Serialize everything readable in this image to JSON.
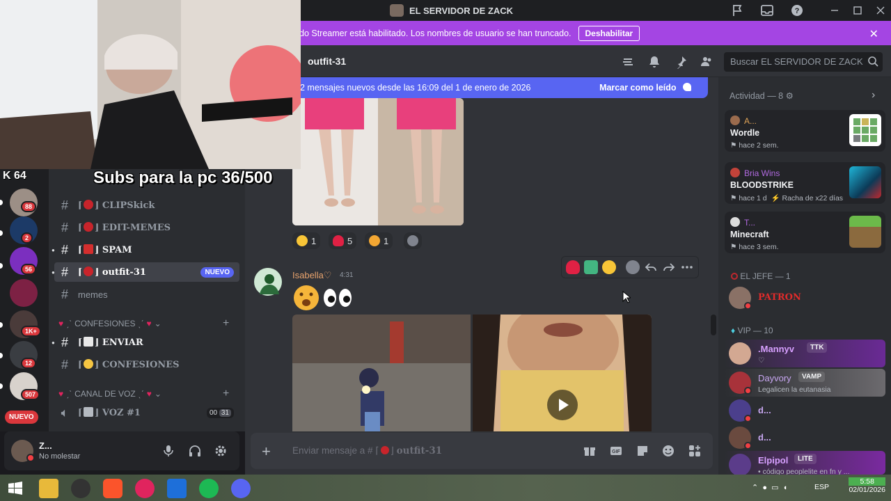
{
  "window": {
    "title": "EL SERVIDOR DE ZACK"
  },
  "banner": {
    "text": "do Streamer está habilitado. Los nombres de usuario se han truncado.",
    "button": "Deshabilitar",
    "close": "✕"
  },
  "overlay": {
    "subs": "Subs para la pc 36/500",
    "kick_viewers": "64"
  },
  "guilds": {
    "badges": [
      "88",
      "2",
      "56",
      "1K+",
      "12",
      "507"
    ],
    "new_label": "NUEVO"
  },
  "channels": {
    "items": [
      {
        "label": "CLIPSkick"
      },
      {
        "label": "EDIT-MEMES"
      },
      {
        "label": "SPAM"
      },
      {
        "label": "outfit-31",
        "badge": "NUEVO"
      },
      {
        "label": "memes"
      }
    ],
    "cat_confesiones": "CONFESIONES",
    "confesiones_items": [
      {
        "label": "ENVIAR"
      },
      {
        "label": "CONFESIONES"
      }
    ],
    "cat_voz": "CANAL DE VOZ",
    "voice": {
      "label": "VOZ #1",
      "count_a": "00",
      "count_b": "31"
    }
  },
  "user": {
    "name": "Z...",
    "status": "No molestar"
  },
  "chat": {
    "channel": "outfit-31",
    "search_placeholder": "Buscar EL SERVIDOR DE ZACK",
    "new_messages": "2 mensajes nuevos desde las 16:09 del 1 de enero de 2026",
    "mark_read": "Marcar como leído",
    "reactions": [
      {
        "emoji": "heart-eyes",
        "count": "1"
      },
      {
        "emoji": "red-heart",
        "count": "5"
      },
      {
        "emoji": "heart-eyes-cat",
        "count": "1"
      }
    ],
    "message": {
      "author": "Isabella♡",
      "time": "4:31"
    },
    "composer_prefix": "Enviar mensaje a #",
    "composer_channel": "outfit-31"
  },
  "members": {
    "activity_header": "Actividad — 8",
    "activities": [
      {
        "who": "A...",
        "game": "Wordle",
        "when": "hace 2 sem."
      },
      {
        "who": "Bria Wins",
        "game": "BLOODSTRIKE",
        "when": "hace 1 d",
        "extra": "Racha de x22 días"
      },
      {
        "who": "T...",
        "game": "Minecraft",
        "when": "hace 3 sem."
      }
    ],
    "role_jefe": "EL JEFE — 1",
    "jefe": [
      {
        "name": "PATRON"
      }
    ],
    "role_vip": "VIP — 10",
    "vip": [
      {
        "name": ".Mannyv",
        "tag": "TTK",
        "sub": "♡"
      },
      {
        "name": "Dayvory",
        "tag": "VAMP",
        "sub": "Legalicen la eutanasia"
      },
      {
        "name": "d..."
      },
      {
        "name": "d..."
      },
      {
        "name": "Elpipol",
        "tag": "LITE",
        "sub": "• código peoplelite en fn y ..."
      }
    ]
  },
  "taskbar": {
    "lang": "ESP",
    "time": "5:58",
    "date": "02/01/2026"
  },
  "colors": {
    "accent": "#5865f2",
    "banner": "#a445e3",
    "dnd": "#f23f43"
  }
}
